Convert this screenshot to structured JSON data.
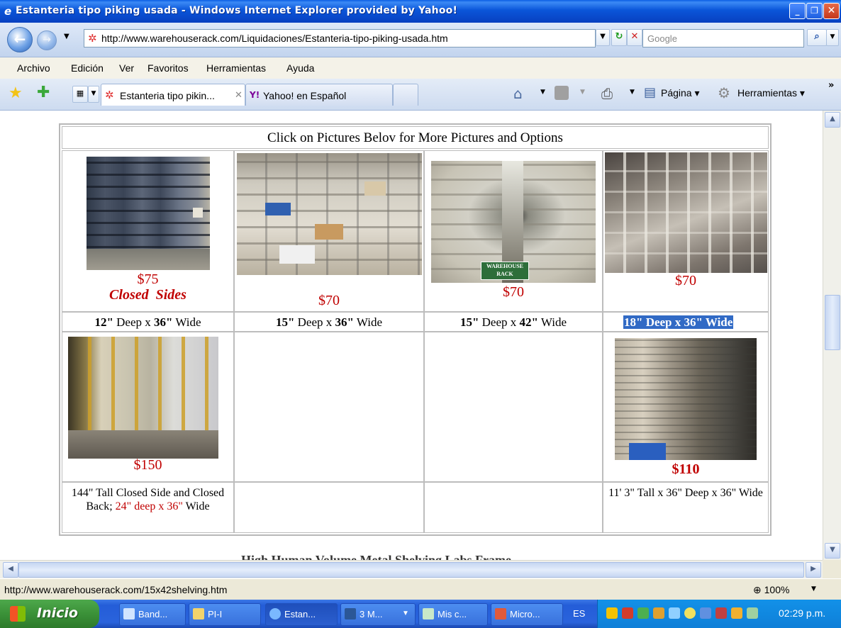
{
  "window": {
    "title": "Estanteria tipo piking usada - Windows Internet Explorer provided by Yahoo!"
  },
  "navbar": {
    "url": "http://www.warehouserack.com/Liquidaciones/Estanteria-tipo-piking-usada.htm",
    "search_placeholder": "Google"
  },
  "menu": [
    "Archivo",
    "Edición",
    "Ver",
    "Favoritos",
    "Herramientas",
    "Ayuda"
  ],
  "tabs": [
    {
      "label": "Estanteria tipo pikin..."
    },
    {
      "label": "Yahoo! en Español"
    }
  ],
  "commandbar": {
    "page_label": "Página ▾",
    "tools_label": "Herramientas ▾"
  },
  "page": {
    "header": "Click on Pictures Belov for More Pictures and Options",
    "row1": [
      {
        "price": "$75",
        "note": "Closed  Sides",
        "dims": [
          "12\"",
          " Deep x ",
          "36\"",
          " Wide"
        ]
      },
      {
        "price": "$70",
        "dims": [
          "15\"",
          " Deep x ",
          "36\"",
          " Wide"
        ]
      },
      {
        "price": "$70",
        "watermark": "WAREHOUSE RACK",
        "dims": [
          "15\"",
          " Deep x ",
          "42\"",
          " Wide"
        ]
      },
      {
        "price": "$70",
        "dims_highlight": "18\" Deep x 36\" Wide"
      }
    ],
    "row2": [
      {
        "price": "$150",
        "desc_a": "144\" Tall Closed Side and Closed Back; ",
        "desc_b": "24\" deep x 36\"",
        "desc_c": " Wide"
      },
      {
        "price": "$110",
        "desc_a": "11' 3\" Tall  x 36\" Deep x 36\" Wide"
      }
    ],
    "footer_partial": "High Human Volume Metal Shelving Labs Frame"
  },
  "status": {
    "url": "http://www.warehouserack.com/15x42shelving.htm",
    "zoom": "100%"
  },
  "taskbar": {
    "start": "Inicio",
    "items": [
      "Band...",
      "PI-I",
      "Estan...",
      "3 M...",
      "Mis c...",
      "Micro..."
    ],
    "lang": "ES",
    "clock": "02:29 p.m."
  },
  "colors": {
    "price": "#c00000",
    "highlight": "#316ac5"
  }
}
